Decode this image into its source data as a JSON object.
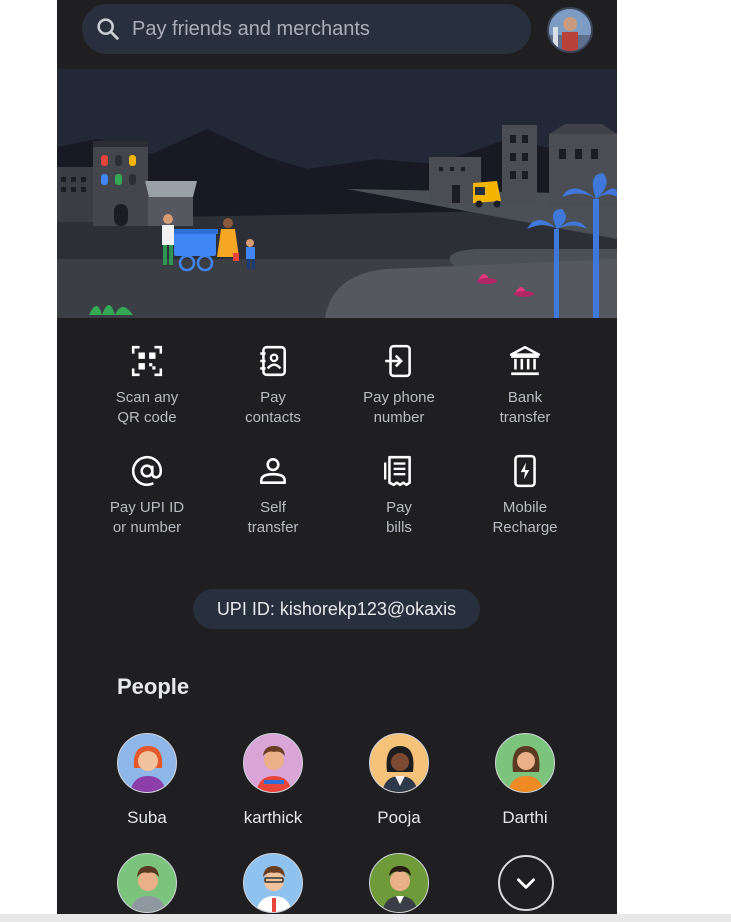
{
  "search": {
    "placeholder": "Pay friends and merchants",
    "icon": "search-icon"
  },
  "profile": {
    "icon": "avatar"
  },
  "actions": [
    {
      "line1": "Scan any",
      "line2": "QR code",
      "icon": "qr-scan-icon"
    },
    {
      "line1": "Pay",
      "line2": "contacts",
      "icon": "contacts-icon"
    },
    {
      "line1": "Pay phone",
      "line2": "number",
      "icon": "phone-transfer-icon"
    },
    {
      "line1": "Bank",
      "line2": "transfer",
      "icon": "bank-icon"
    },
    {
      "line1": "Pay UPI ID",
      "line2": "or number",
      "icon": "at-sign-icon"
    },
    {
      "line1": "Self",
      "line2": "transfer",
      "icon": "person-icon"
    },
    {
      "line1": "Pay",
      "line2": "bills",
      "icon": "bill-receipt-icon"
    },
    {
      "line1": "Mobile",
      "line2": "Recharge",
      "icon": "mobile-recharge-icon"
    }
  ],
  "upi": {
    "label": "UPI ID: kishorekp123@okaxis"
  },
  "people": {
    "title": "People",
    "contacts": [
      {
        "name": "Suba"
      },
      {
        "name": "karthick"
      },
      {
        "name": "Pooja"
      },
      {
        "name": "Darthi"
      },
      {
        "name": ""
      },
      {
        "name": ""
      },
      {
        "name": ""
      }
    ],
    "more_icon": "chevron-down-icon"
  },
  "colors": {
    "background": "#1f1f21",
    "pill": "#29303d",
    "text": "#e6e7ea",
    "muted": "#b9bcc2"
  }
}
